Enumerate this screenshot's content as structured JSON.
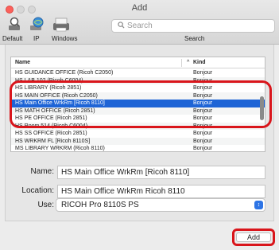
{
  "window": {
    "title": "Add"
  },
  "toolbar": {
    "items": [
      {
        "label": "Default",
        "icon": "printer-icon"
      },
      {
        "label": "IP",
        "icon": "globe-icon"
      },
      {
        "label": "Windows",
        "icon": "windows-printer-icon"
      }
    ],
    "search_placeholder": "Search",
    "search_label": "Search"
  },
  "table": {
    "columns": {
      "name": "Name",
      "kind": "Kind"
    },
    "rows": [
      {
        "name": "HS GUIDANCE OFFICE (Ricoh C2050)",
        "kind": "Bonjour"
      },
      {
        "name": "HS LAB 102 (Ricoh C6004)",
        "kind": "Bonjour"
      },
      {
        "name": "HS LIBRARY (Ricoh 2851)",
        "kind": "Bonjour"
      },
      {
        "name": "HS MAIN OFFICE (Ricoh C2050)",
        "kind": "Bonjour"
      },
      {
        "name": "HS Main Office WrkRm [Ricoh 8110]",
        "kind": "Bonjour",
        "selected": true
      },
      {
        "name": "HS MATH OFFICE (Ricoh 2851)",
        "kind": "Bonjour"
      },
      {
        "name": "HS PE OFFICE (Ricoh 2851)",
        "kind": "Bonjour"
      },
      {
        "name": "HS Room 514 (Ricoh C6004)",
        "kind": "Bonjour"
      },
      {
        "name": "HS SS OFFICE (Ricoh 2851)",
        "kind": "Bonjour"
      },
      {
        "name": "HS WRKRM FL  [Ricoh 8110S]",
        "kind": "Bonjour"
      },
      {
        "name": "MS LIBRARY WRKRM (Ricoh 8110)",
        "kind": "Bonjour"
      }
    ]
  },
  "form": {
    "name_label": "Name:",
    "name_value": "HS Main Office WrkRm [Ricoh 8110]",
    "location_label": "Location:",
    "location_value": "HS Main Office WrkRm Ricoh 8110",
    "use_label": "Use:",
    "use_value": "RICOH Pro 8110S PS"
  },
  "actions": {
    "add_label": "Add"
  },
  "colors": {
    "selection": "#1e64d6",
    "annotation": "#d9151b"
  }
}
